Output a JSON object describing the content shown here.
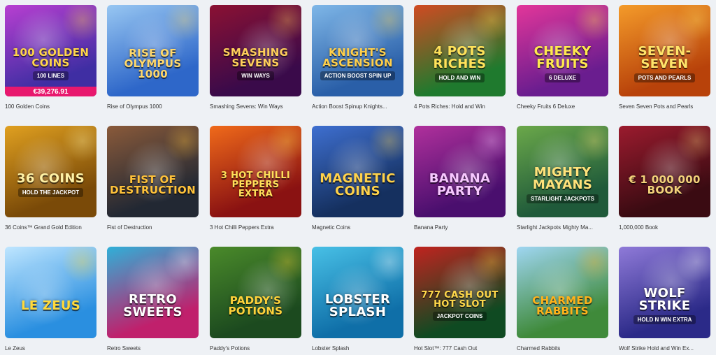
{
  "games": [
    {
      "id": "g1",
      "title": "100 Golden Coins",
      "logo": "100 GOLDEN COINS",
      "sub": "100 LINES",
      "jackpot": "€39,276.91",
      "bg": "#3f2ea3",
      "bg2": "#b83fd1",
      "fg": "#ffd54a"
    },
    {
      "id": "g2",
      "title": "Rise of Olympus 1000",
      "logo": "RISE OF OLYMPUS 1000",
      "bg": "#2e67c9",
      "bg2": "#98c7f2",
      "fg": "#ffd86b"
    },
    {
      "id": "g3",
      "title": "Smashing Sevens: Win Ways",
      "logo": "SMASHING SEVENS",
      "sub": "WIN WAYS",
      "bg": "#3a0a4a",
      "bg2": "#8b1133",
      "fg": "#ffcf5a"
    },
    {
      "id": "g4",
      "title": "Action Boost Spinup Knights...",
      "logo": "KNIGHT'S ASCENSION",
      "sub": "ACTION BOOST SPIN UP",
      "bg": "#2a5fa8",
      "bg2": "#7fb7e8",
      "fg": "#ffcf4a"
    },
    {
      "id": "g5",
      "title": "4 Pots Riches: Hold and Win",
      "logo": "4 POTS RICHES",
      "sub": "HOLD AND WIN",
      "bg": "#1f7a2e",
      "bg2": "#d14a22",
      "fg": "#ffe25a"
    },
    {
      "id": "g6",
      "title": "Cheeky Fruits 6 Deluxe",
      "logo": "CHEEKY FRUITS",
      "sub": "6 DELUXE",
      "bg": "#6a1d8f",
      "bg2": "#e3369a",
      "fg": "#ffe94d"
    },
    {
      "id": "g7",
      "title": "Seven Seven Pots and Pearls",
      "logo": "SEVEN-SEVEN",
      "sub": "POTS AND PEARLS",
      "bg": "#b8420a",
      "bg2": "#f49b2a",
      "fg": "#ffe46a"
    },
    {
      "id": "g8",
      "title": "36 Coins™ Grand Gold Edition",
      "logo": "36 COINS",
      "sub": "HOLD THE JACKPOT",
      "bg": "#7a4a08",
      "bg2": "#e0a020",
      "fg": "#fff2a6"
    },
    {
      "id": "g9",
      "title": "Fist of Destruction",
      "logo": "FIST OF DESTRUCTION",
      "bg": "#222833",
      "bg2": "#8a5a3a",
      "fg": "#ffc23a"
    },
    {
      "id": "g10",
      "title": "3 Hot Chilli Peppers Extra",
      "logo": "3 HOT CHILLI PEPPERS EXTRA",
      "bg": "#8a1212",
      "bg2": "#f06a1a",
      "fg": "#ffe05a"
    },
    {
      "id": "g11",
      "title": "Magnetic Coins",
      "logo": "MAGNETIC COINS",
      "bg": "#15305f",
      "bg2": "#3e6fd0",
      "fg": "#ffd24a"
    },
    {
      "id": "g12",
      "title": "Banana Party",
      "logo": "BANANA PARTY",
      "bg": "#4a0f6e",
      "bg2": "#b0309c",
      "fg": "#f7c8ff"
    },
    {
      "id": "g13",
      "title": "Starlight Jackpots Mighty Ma...",
      "logo": "MIGHTY MAYANS",
      "sub": "STARLIGHT JACKPOTS",
      "bg": "#1f5a3a",
      "bg2": "#6ba84a",
      "fg": "#ffe27a"
    },
    {
      "id": "g14",
      "title": "1,000,000 Book",
      "logo": "€ 1 000 000 BOOK",
      "bg": "#3a0b12",
      "bg2": "#9b1b2e",
      "fg": "#f3d27a"
    },
    {
      "id": "g15",
      "title": "Le Zeus",
      "logo": "LE ZEUS",
      "bg": "#2a8fe0",
      "bg2": "#bfe6ff",
      "fg": "#ffd93a"
    },
    {
      "id": "g16",
      "title": "Retro Sweets",
      "logo": "RETRO SWEETS",
      "bg": "#c0206c",
      "bg2": "#2fb0d8",
      "fg": "#ffffff"
    },
    {
      "id": "g17",
      "title": "Paddy's Potions",
      "logo": "PADDY'S POTIONS",
      "bg": "#1c4a1f",
      "bg2": "#4a8a2a",
      "fg": "#ffd23a"
    },
    {
      "id": "g18",
      "title": "Lobster Splash",
      "logo": "LOBSTER SPLASH",
      "bg": "#0f6fa8",
      "bg2": "#48c0e6",
      "fg": "#ffffff"
    },
    {
      "id": "g19",
      "title": "Hot Slot™: 777 Cash Out",
      "logo": "777 CASH OUT HOT SLOT",
      "sub": "JACKPOT COINS",
      "bg": "#0f4a22",
      "bg2": "#c0231f",
      "fg": "#ffd84a"
    },
    {
      "id": "g20",
      "title": "Charmed Rabbits",
      "logo": "CHARMED RABBITS",
      "bg": "#3f8a3a",
      "bg2": "#9fd6f2",
      "fg": "#ffb21a"
    },
    {
      "id": "g21",
      "title": "Wolf Strike Hold and Win Ex...",
      "logo": "WOLF STRIKE",
      "sub": "HOLD N WIN EXTRA",
      "bg": "#2b2a88",
      "bg2": "#8f7ad8",
      "fg": "#ffffff"
    }
  ]
}
